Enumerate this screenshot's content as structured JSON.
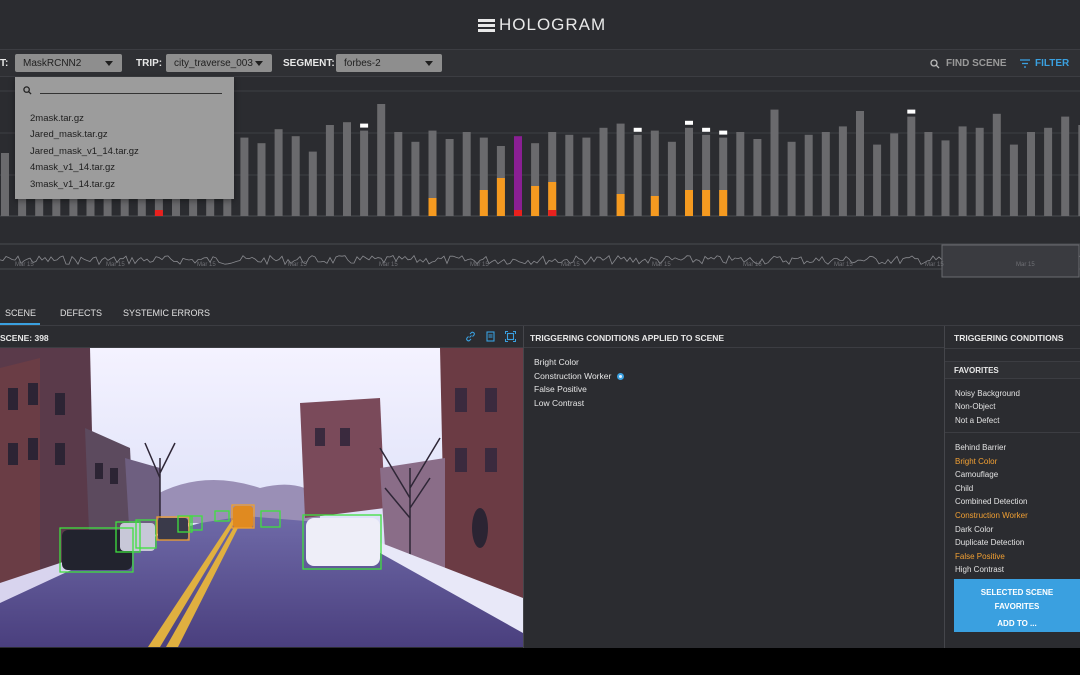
{
  "header": {
    "title": "HOLOGRAM"
  },
  "filters": {
    "model_label": "T:",
    "model_value": "MaskRCNN2",
    "trip_label": "TRIP:",
    "trip_value": "city_traverse_003",
    "segment_label": "SEGMENT:",
    "segment_value": "forbes-2",
    "find_scene": "FIND SCENE",
    "filter": "FILTER"
  },
  "dropdown": {
    "options": [
      "2mask.tar.gz",
      "Jared_mask.tar.gz",
      "Jared_mask_v1_14.tar.gz",
      "4mask_v1_14.tar.gz",
      "3mask_v1_14.tar.gz"
    ]
  },
  "chart_data": {
    "type": "bar",
    "values": [
      45,
      58,
      66,
      60,
      54,
      64,
      70,
      55,
      80,
      64,
      57,
      62,
      60,
      72,
      56,
      52,
      62,
      57,
      46,
      65,
      67,
      61,
      80,
      60,
      53,
      61,
      55,
      60,
      56,
      50,
      57,
      52,
      60,
      58,
      56,
      63,
      66,
      58,
      61,
      53,
      63,
      58,
      56,
      60,
      55,
      76,
      53,
      58,
      60,
      64,
      75,
      51,
      59,
      71,
      60,
      54,
      64,
      63,
      73,
      51,
      60,
      63,
      71,
      65,
      66,
      68,
      58,
      56,
      54,
      70,
      57,
      62,
      58
    ],
    "colors": {
      "gray": "#6a6a6d",
      "orange": "#f59a20",
      "red": "#e8211e",
      "purple": "#8a1f94",
      "white_marker": "#ffffff"
    }
  },
  "timeline": {
    "tick_label": "Mar 15"
  },
  "tabs": [
    "SCENE",
    "DEFECTS",
    "SYSTEMIC ERRORS"
  ],
  "scene": {
    "title": "SCENE: 398"
  },
  "triggering": {
    "header": "TRIGGERING CONDITIONS APPLIED TO SCENE",
    "items": [
      "Bright Color",
      "Construction Worker",
      "False Positive",
      "Low Contrast"
    ]
  },
  "right_panel": {
    "header": "TRIGGERING CONDITIONS",
    "favorites_label": "FAVORITES",
    "favorites": [
      "Noisy Background",
      "Non-Object",
      "Not a Defect"
    ],
    "conditions": [
      {
        "label": "Behind Barrier",
        "active": false
      },
      {
        "label": "Bright Color",
        "active": true
      },
      {
        "label": "Camouflage",
        "active": false
      },
      {
        "label": "Child",
        "active": false
      },
      {
        "label": "Combined Detection",
        "active": false
      },
      {
        "label": "Construction Worker",
        "active": true
      },
      {
        "label": "Dark Color",
        "active": false
      },
      {
        "label": "Duplicate Detection",
        "active": false
      },
      {
        "label": "False Positive",
        "active": true
      },
      {
        "label": "High Contrast",
        "active": false
      }
    ],
    "button_line1": "SELECTED SCENE",
    "button_line2": "FAVORITES",
    "button_line3": "ADD TO ..."
  }
}
